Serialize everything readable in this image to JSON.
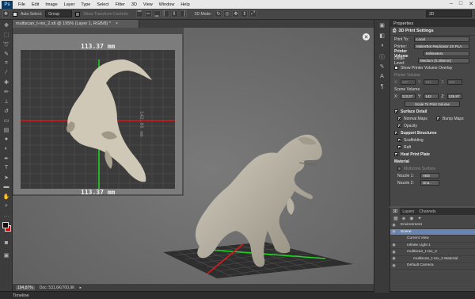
{
  "app": {
    "logo": "Ps"
  },
  "menu": [
    "File",
    "Edit",
    "Image",
    "Layer",
    "Type",
    "Select",
    "Filter",
    "3D",
    "View",
    "Window",
    "Help"
  ],
  "window_controls": {
    "minimize": "–",
    "maximize": "□",
    "close": "✕"
  },
  "options_bar": {
    "auto_select_label": "Auto-Select:",
    "auto_select_value": "Group",
    "show_transform_label": "Show Transform Controls",
    "mode_label": "3D Mode:",
    "workspace_value": "3D"
  },
  "document": {
    "tab_title": "multiscan_t-rex_2.stl @ 195% (Layer 1, RGB/8) *",
    "zoom": "194,87%",
    "doc_size": "Doc: 531,6K/700,9K"
  },
  "inset": {
    "dimension_top": "113.37 mm",
    "dimension_bottom": "113.37 mm",
    "dimension_side": "142.00 mm"
  },
  "properties": {
    "tab": "Properties",
    "header": "3D Print Settings",
    "print_to_label": "Print To:",
    "print_to_value": "Local",
    "printer_label": "Printer:",
    "printer_value": "MakerBot Replicator 2X PLA",
    "printer_volume_label": "Printer Volume",
    "printer_volume_unit": "Millimeters",
    "detail_level_label": "Detail Level:",
    "detail_level_value": "Medium (0.285mm)",
    "show_overlay_label": "Show Printer Volume Overlay",
    "printer_volume_sub": "Printer Volume",
    "printer_volume_values": {
      "x": "137",
      "y": "141",
      "z": "150"
    },
    "scene_volume_label": "Scene Volume",
    "scene_volume_values": {
      "x": "113,37",
      "y": "142",
      "z": "135,97"
    },
    "axis_x": "X:",
    "axis_y": "Y:",
    "axis_z": "Z:",
    "scale_button": "Scale To Print Volume",
    "surface_detail_label": "Surface Detail",
    "normal_maps_label": "Normal Maps",
    "bump_maps_label": "Bump Maps",
    "opacity_label": "Opacity",
    "support_structures_label": "Support Structures",
    "scaffolding_label": "Scaffolding",
    "raft_label": "Raft",
    "heat_print_plate_label": "Heat Print Plate",
    "material_label": "Material",
    "multizone_label": "Multizone Surface",
    "nozzle1_label": "Nozzle 1:",
    "nozzle1_value": "ABS",
    "nozzle2_label": "Nozzle 2:",
    "nozzle2_value": "Unu.."
  },
  "layers_panel": {
    "tabs": [
      "3D",
      "Layers",
      "Channels"
    ],
    "rows": [
      {
        "label": "Environment",
        "indent": 0,
        "selected": false
      },
      {
        "label": "Scene",
        "indent": 0,
        "selected": true
      },
      {
        "label": "Current View",
        "indent": 1,
        "selected": false
      },
      {
        "label": "Infinite Light 1",
        "indent": 1,
        "selected": false
      },
      {
        "label": "multiscan_t-rex_2",
        "indent": 1,
        "selected": false
      },
      {
        "label": "multiscan_t-rex_2 Material",
        "indent": 2,
        "selected": false
      },
      {
        "label": "Default Camera",
        "indent": 1,
        "selected": false
      }
    ]
  },
  "timeline": {
    "label": "Timeline"
  },
  "colors": {
    "accent": "#6a86b0",
    "grid_red": "#d11",
    "grid_green": "#1c1"
  }
}
